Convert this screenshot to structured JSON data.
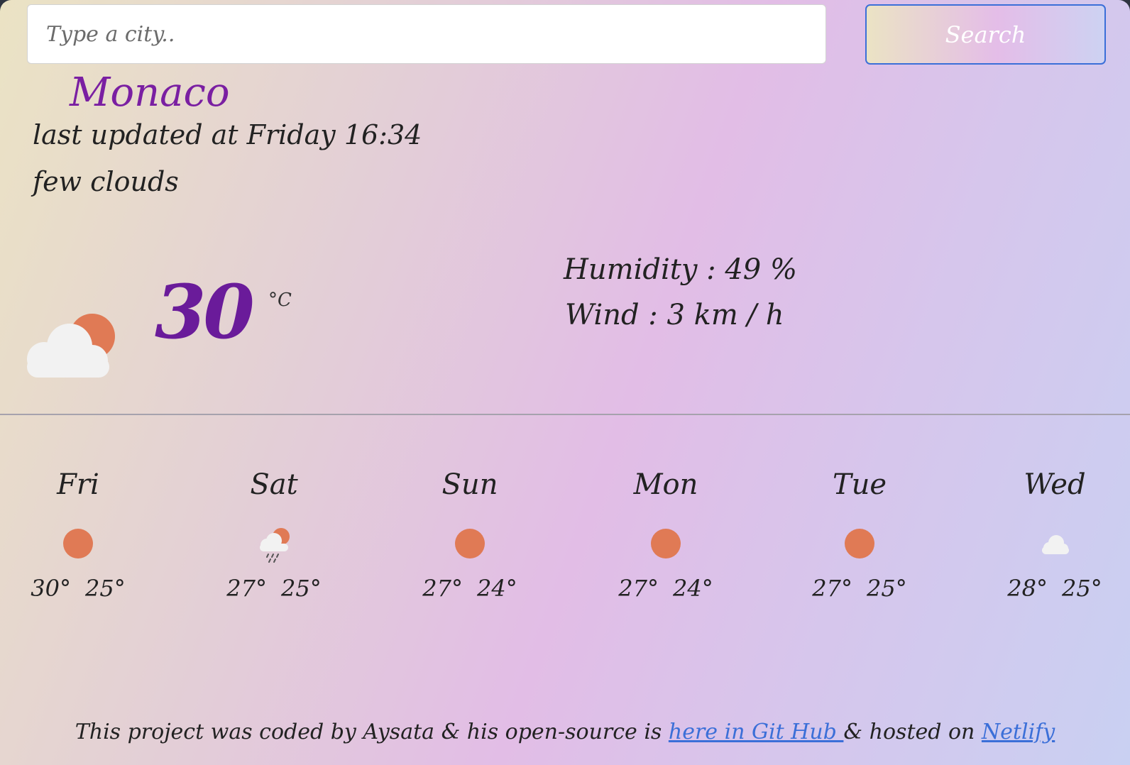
{
  "search": {
    "placeholder": "Type a city..",
    "button_label": "Search"
  },
  "current": {
    "city": "Monaco",
    "last_updated": "last updated at Friday 16:34",
    "description": "few clouds",
    "icon": "few-clouds-day-icon",
    "temperature": "30",
    "unit": "°C",
    "humidity": "Humidity : 49 %",
    "wind": "Wind : 3 km / h"
  },
  "forecast": [
    {
      "day": "Fri",
      "icon": "clear-sky-icon",
      "max": "30°",
      "min": "25°"
    },
    {
      "day": "Sat",
      "icon": "rain-day-icon",
      "max": "27°",
      "min": "25°"
    },
    {
      "day": "Sun",
      "icon": "clear-sky-icon",
      "max": "27°",
      "min": "24°"
    },
    {
      "day": "Mon",
      "icon": "clear-sky-icon",
      "max": "27°",
      "min": "24°"
    },
    {
      "day": "Tue",
      "icon": "clear-sky-icon",
      "max": "27°",
      "min": "25°"
    },
    {
      "day": "Wed",
      "icon": "cloud-icon",
      "max": "28°",
      "min": "25°"
    }
  ],
  "footer": {
    "text_1": "This project was coded by Aysata & his open-source is ",
    "github_link": "here in Git Hub ",
    "text_2": "& hosted on ",
    "netlify_link": "Netlify"
  },
  "colors": {
    "city": "#7a1fa2",
    "temperature": "#6a1b9a",
    "sun": "#e07a55",
    "cloud": "#f2f2f2",
    "link": "#3b6fd8",
    "button_border": "#3b6fd8"
  }
}
